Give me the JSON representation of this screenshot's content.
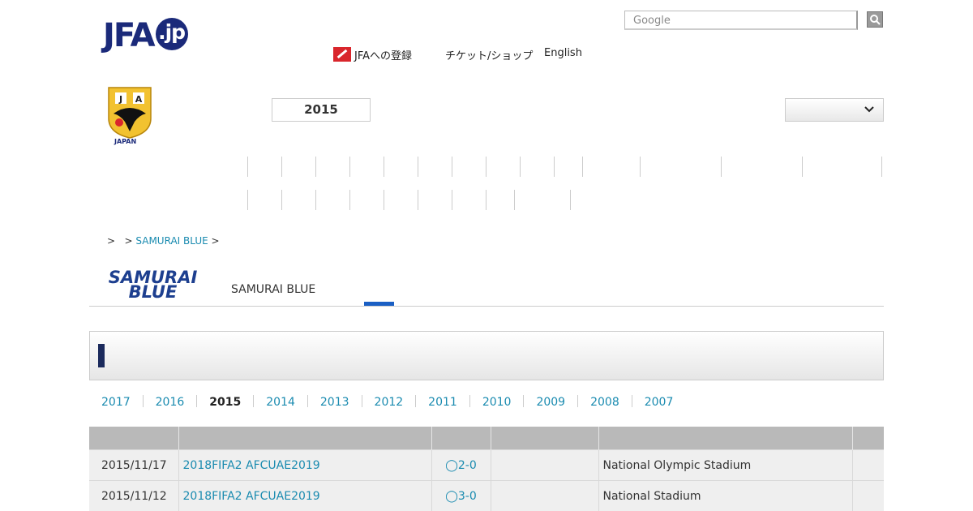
{
  "header": {
    "logo_text": "JFA",
    "logo_suffix": ".jp",
    "search_placeholder": "Google",
    "nav": [
      "JFAへの登録",
      "チケット/ショップ",
      "English"
    ]
  },
  "emblem": {
    "label": "JAPAN"
  },
  "filter": {
    "year": "2015",
    "select_value": ""
  },
  "breadcrumb": {
    "sep1": ">",
    "sep2": ">",
    "link": "SAMURAI BLUE",
    "sep3": ">"
  },
  "samurai": {
    "logo_line1": "SAMURAI",
    "logo_line2": "BLUE",
    "title": "SAMURAI BLUE"
  },
  "years": [
    {
      "label": "2017",
      "active": false
    },
    {
      "label": "2016",
      "active": false
    },
    {
      "label": "2015",
      "active": true
    },
    {
      "label": "2014",
      "active": false
    },
    {
      "label": "2013",
      "active": false
    },
    {
      "label": "2012",
      "active": false
    },
    {
      "label": "2011",
      "active": false
    },
    {
      "label": "2010",
      "active": false
    },
    {
      "label": "2009",
      "active": false
    },
    {
      "label": "2008",
      "active": false
    },
    {
      "label": "2007",
      "active": false
    }
  ],
  "matches": [
    {
      "date": "2015/11/17",
      "competition": "2018FIFA2  AFCUAE2019",
      "score": "◯2-0",
      "opponent": "",
      "venue": "National Olympic Stadium",
      "note": ""
    },
    {
      "date": "2015/11/12",
      "competition": "2018FIFA2  AFCUAE2019",
      "score": "◯3-0",
      "opponent": "",
      "venue": "National Stadium",
      "note": ""
    }
  ],
  "colors": {
    "link": "#1a8bb0",
    "brand": "#1b2a7a",
    "accent": "#1a5fc4"
  }
}
